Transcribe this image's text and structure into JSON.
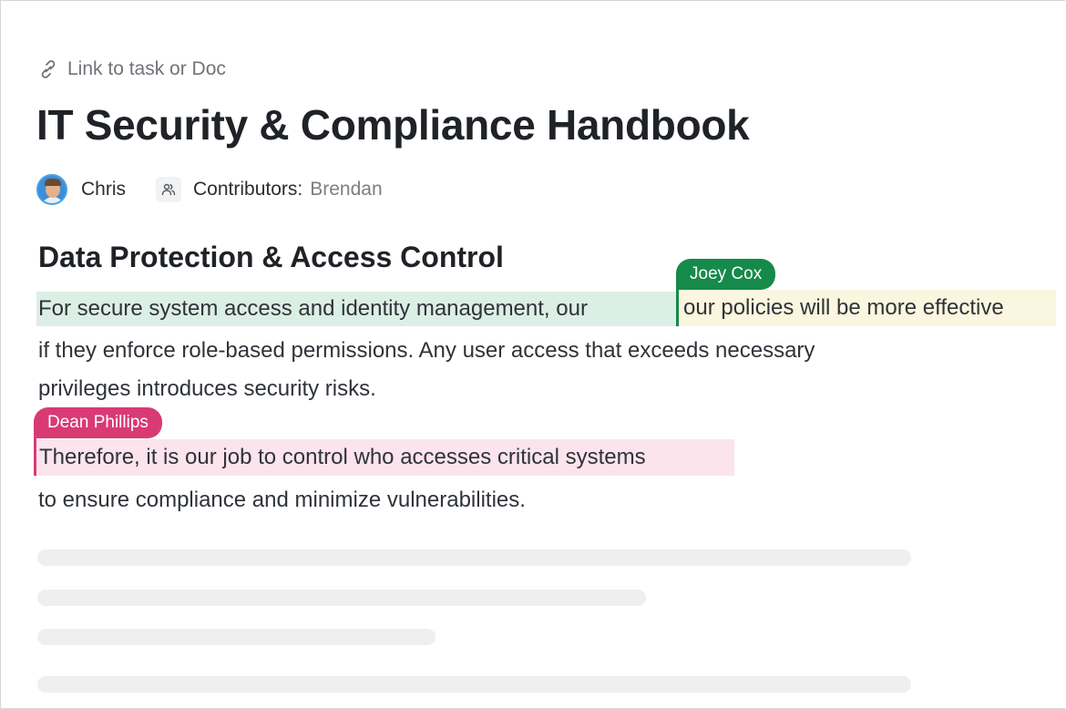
{
  "link": {
    "label": "Link to task or Doc",
    "icon": "link-icon"
  },
  "document": {
    "title": "IT Security & Compliance Handbook",
    "owner": {
      "name": "Chris",
      "icon": "avatar"
    },
    "contributors": {
      "label": "Contributors:",
      "names": "Brendan",
      "icon": "people-icon"
    }
  },
  "section": {
    "heading": "Data Protection & Access Control",
    "lines": [
      "For secure system access and identity management, our",
      "our policies will be more effective",
      "if they enforce role-based permissions. Any user access that exceeds necessary",
      "privileges introduces security risks.",
      "Therefore, it is our job to control who accesses critical systems",
      "to ensure compliance and minimize vulnerabilities."
    ]
  },
  "collaborators": [
    {
      "name": "Joey Cox",
      "color": "#168a4a"
    },
    {
      "name": "Dean Phillips",
      "color": "#d93a74"
    }
  ],
  "highlight_colors": {
    "green": "#dcefe5",
    "yellow": "#fbf6df",
    "pink": "#fbe4ec"
  }
}
